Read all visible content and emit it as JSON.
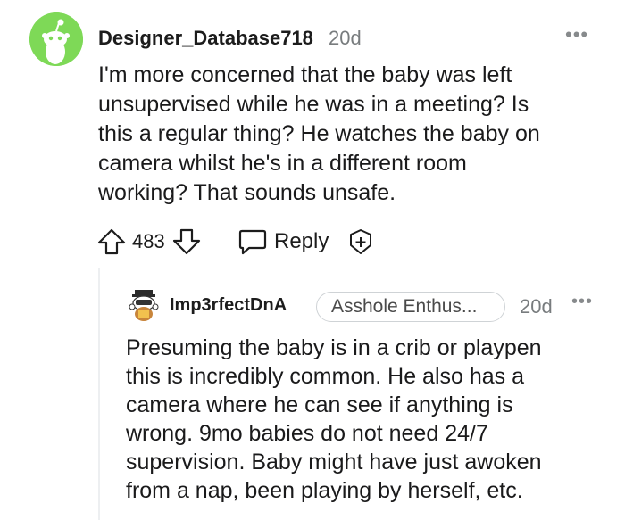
{
  "comment1": {
    "username": "Designer_Database718",
    "time": "20d",
    "more_icon": "•••",
    "body_lines": [
      "I'm more concerned that the baby was left",
      "unsupervised while he was in a meeting? Is",
      "this a regular thing? He watches the baby on",
      "camera whilst he's in a different room",
      "working? That sounds unsafe."
    ],
    "score": "483",
    "reply_label": "Reply",
    "avatar_color": "#7ed957"
  },
  "comment2": {
    "username": "Imp3rfectDnA",
    "flair": "Asshole Enthus...",
    "time": "20d",
    "more_icon": "•••",
    "body_lines": [
      "Presuming the baby is in a crib or playpen",
      "this is incredibly common. He also has a",
      "camera where he can see if anything is",
      "wrong. 9mo babies do not need 24/7",
      "supervision. Baby might have just awoken",
      "from a nap, been playing by herself, etc."
    ]
  }
}
